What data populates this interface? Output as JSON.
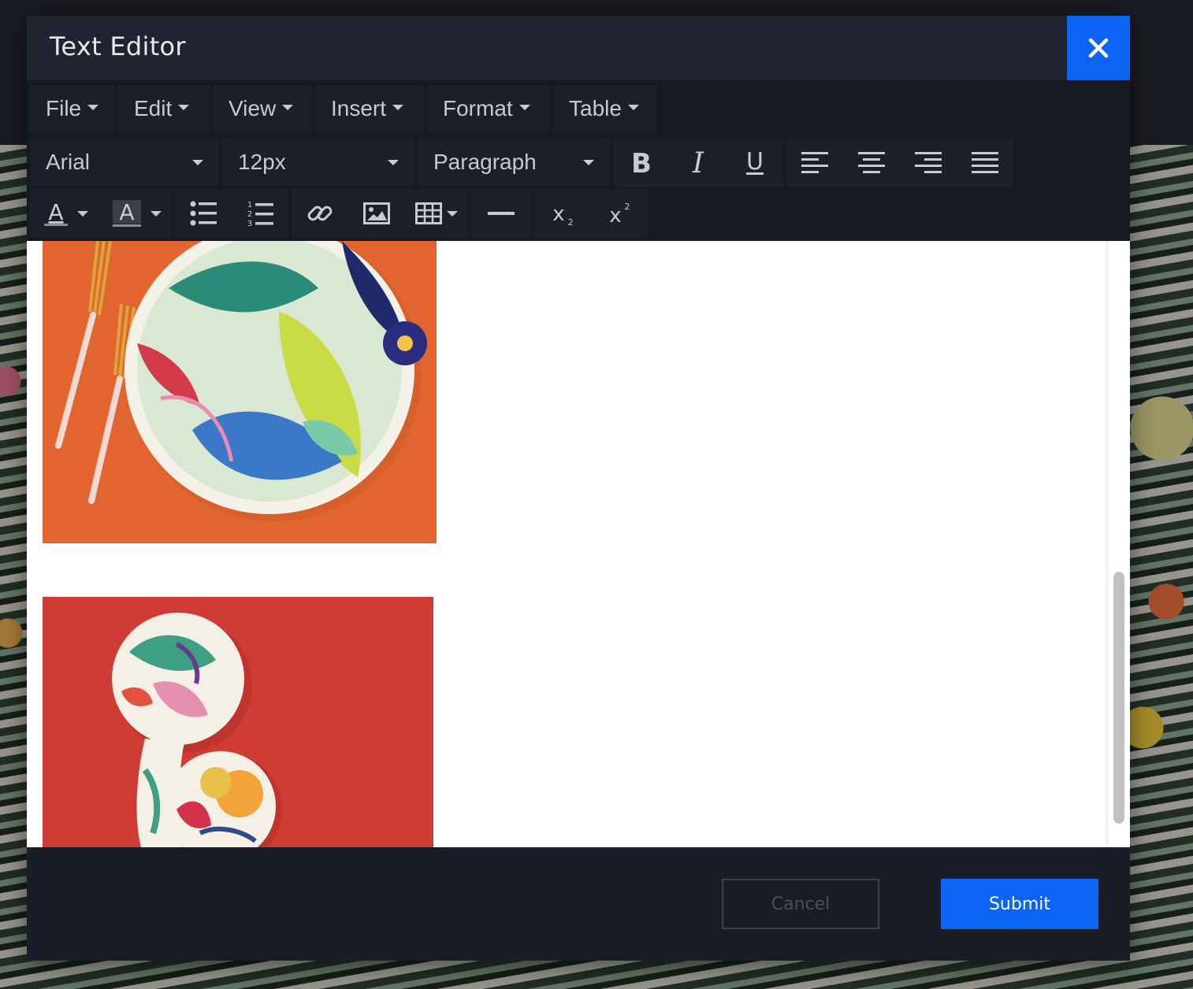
{
  "dialog": {
    "title": "Text Editor",
    "close_icon": "close-icon"
  },
  "menubar": {
    "items": [
      {
        "label": "File"
      },
      {
        "label": "Edit"
      },
      {
        "label": "View"
      },
      {
        "label": "Insert"
      },
      {
        "label": "Format"
      },
      {
        "label": "Table"
      }
    ]
  },
  "format_toolbar": {
    "font_family": "Arial",
    "font_size": "12px",
    "block_format": "Paragraph",
    "icons": [
      "bold-icon",
      "italic-icon",
      "underline-icon",
      "align-left-icon",
      "align-center-icon",
      "align-right-icon",
      "align-justify-icon"
    ]
  },
  "insert_toolbar": {
    "icons": [
      "text-color-icon",
      "background-color-icon",
      "bullet-list-icon",
      "numbered-list-icon",
      "link-icon",
      "image-icon",
      "table-icon",
      "horizontal-rule-icon",
      "subscript-icon",
      "superscript-icon"
    ]
  },
  "content": {
    "images": [
      "plate-image",
      "spoon-rest-image"
    ]
  },
  "footer": {
    "cancel_label": "Cancel",
    "submit_label": "Submit"
  },
  "colors": {
    "accent": "#0b64f4",
    "title_bar": "#202430",
    "toolbar": "#161922",
    "button_bg": "#1c1f29",
    "icon": "#c7cad3",
    "image1_bg": "#e2652f",
    "image2_bg": "#cf3b35"
  }
}
